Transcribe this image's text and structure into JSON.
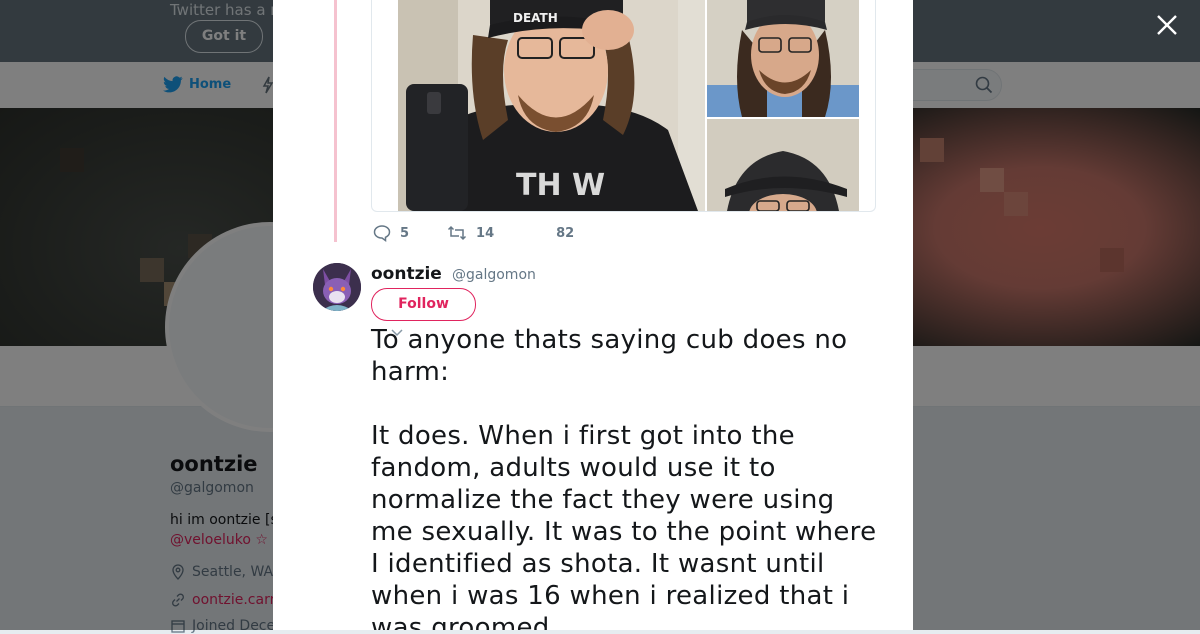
{
  "banner": {
    "text": "Twitter has a n",
    "got_it": "Got it"
  },
  "nav": {
    "home": "Home",
    "search_placeholder": ""
  },
  "profile": {
    "name": "oontzie",
    "handle": "@galgomon",
    "bio": "hi im oontzie [s",
    "mention": "@veloeluko ☆",
    "location": "Seattle, WA",
    "link": "oontzie.carr",
    "joined": "Joined Dece"
  },
  "tweet_stats": {
    "replies": "5",
    "retweets": "14",
    "likes": "82"
  },
  "tweet": {
    "name": "oontzie",
    "handle": "@galgomon",
    "follow_label": "Follow",
    "paragraph1": "To anyone thats saying cub does no harm:",
    "paragraph2": "It does. When i first got into the fandom, adults would use it to normalize the fact they were using me sexually. It was to the point where I identified as shota. It wasnt until when i was 16 when i realized that i was groomed."
  },
  "colors": {
    "brand_blue": "#1da1f2",
    "accent_red": "#e0245e",
    "thread_pink": "#f5c2cf"
  },
  "icons": [
    "twitter-bird-icon",
    "search-icon",
    "close-icon",
    "reply-icon",
    "retweet-icon",
    "location-icon",
    "link-icon",
    "calendar-icon"
  ]
}
